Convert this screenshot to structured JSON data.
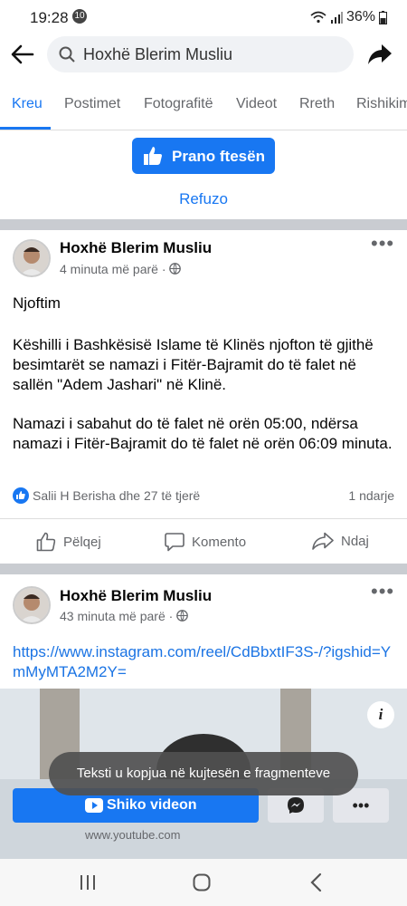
{
  "status": {
    "time": "19:28",
    "notif_count": "10",
    "battery": "36%"
  },
  "search": {
    "query": "Hoxhë Blerim Musliu"
  },
  "tabs": [
    "Kreu",
    "Postimet",
    "Fotografitë",
    "Videot",
    "Rreth",
    "Rishikim"
  ],
  "page_actions": {
    "accept_label": "Prano ftesën",
    "decline_label": "Refuzo"
  },
  "post1": {
    "author": "Hoxhë Blerim Musliu",
    "time": "4 minuta më parë",
    "title": "Njoftim",
    "para1": "Këshilli i Bashkësisë Islame të Klinës njofton të gjithë besimtarët se namazi i Fitër-Bajramit do të falet në sallën \"Adem Jashari\" në Klinë.",
    "para2": "Namazi i sabahut do të falet në orën 05:00, ndërsa namazi i Fitër-Bajramit do të falet në orën 06:09 minuta.",
    "reactions": "Salii H Berisha dhe 27 të tjerë",
    "shares": "1 ndarje"
  },
  "actions": {
    "like": "Pëlqej",
    "comment": "Komento",
    "share": "Ndaj"
  },
  "post2": {
    "author": "Hoxhë Blerim Musliu",
    "time": "43 minuta më parë",
    "link": "https://www.instagram.com/reel/CdBbxtIF3S-/?igshid=YmMyMTA2M2Y=",
    "watch_label": "Shiko videon",
    "domain": "www.youtube.com"
  },
  "toast": "Teksti u kopjua në kujtesën e fragmenteve",
  "colors": {
    "accent": "#1877f2",
    "link": "#1b74e4",
    "muted": "#65676b"
  }
}
